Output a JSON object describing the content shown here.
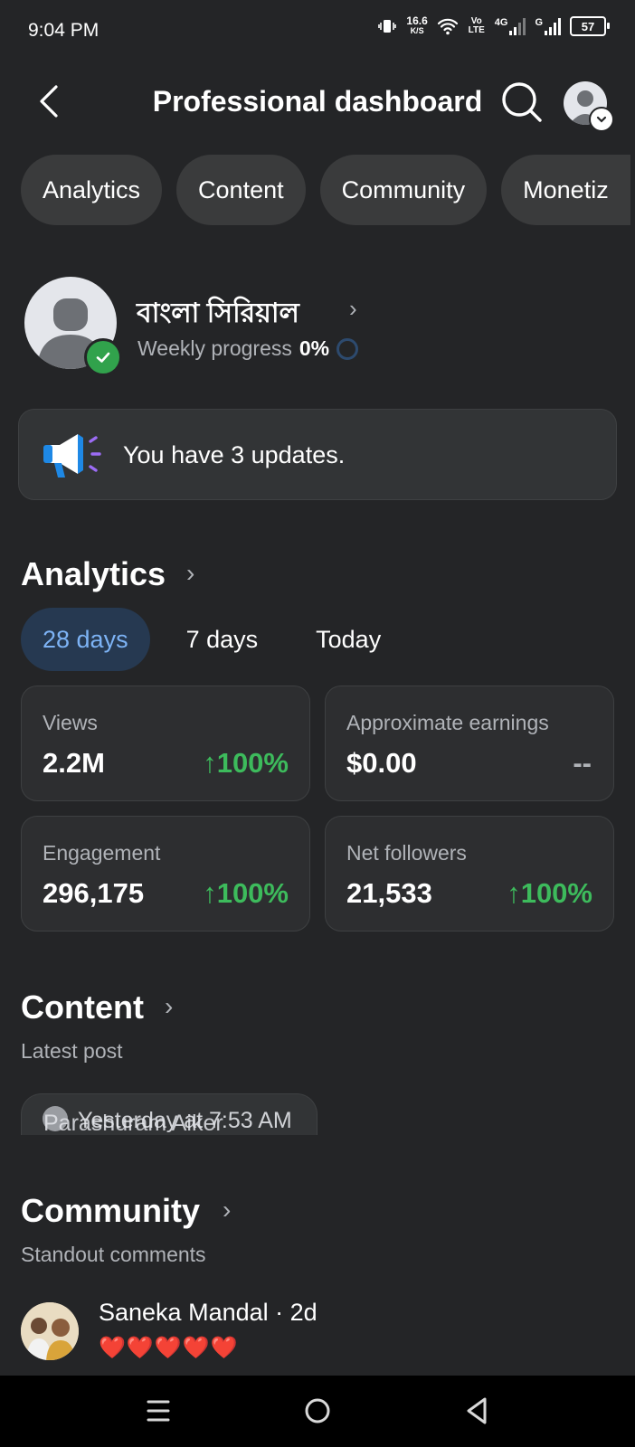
{
  "status_bar": {
    "time": "9:04 PM",
    "net_speed": "16.6",
    "net_unit": "K/S",
    "volte": "Vo LTE",
    "network_4g": "4G",
    "network_g": "G",
    "battery": "57"
  },
  "header": {
    "title": "Professional dashboard"
  },
  "tabs": [
    {
      "label": "Analytics"
    },
    {
      "label": "Content"
    },
    {
      "label": "Community"
    },
    {
      "label": "Monetiz"
    }
  ],
  "profile": {
    "name": "বাংলা সিরিয়াল",
    "weekly_label": "Weekly progress",
    "weekly_value": "0%"
  },
  "updates": {
    "text": "You have 3 updates."
  },
  "analytics": {
    "title": "Analytics",
    "ranges": [
      {
        "label": "28 days",
        "active": true
      },
      {
        "label": "7 days",
        "active": false
      },
      {
        "label": "Today",
        "active": false
      }
    ],
    "metrics": [
      {
        "label": "Views",
        "value": "2.2M",
        "change": "100%"
      },
      {
        "label": "Approximate earnings",
        "value": "$0.00",
        "change": "--"
      },
      {
        "label": "Engagement",
        "value": "296,175",
        "change": "100%"
      },
      {
        "label": "Net followers",
        "value": "21,533",
        "change": "100%"
      }
    ]
  },
  "content": {
    "title": "Content",
    "subtitle": "Latest post",
    "post_time": "Yesterday at 7:53 AM",
    "post_author": "Parashuram Aiker"
  },
  "community": {
    "title": "Community",
    "subtitle": "Standout comments",
    "comment_author": "Saneka Mandal · 2d",
    "comment_text": "❤️❤️❤️❤️❤️"
  },
  "colors": {
    "background": "#242527",
    "positive": "#3dbb5c",
    "accent_blue": "#7db3f5",
    "verified_green": "#31a24c"
  }
}
